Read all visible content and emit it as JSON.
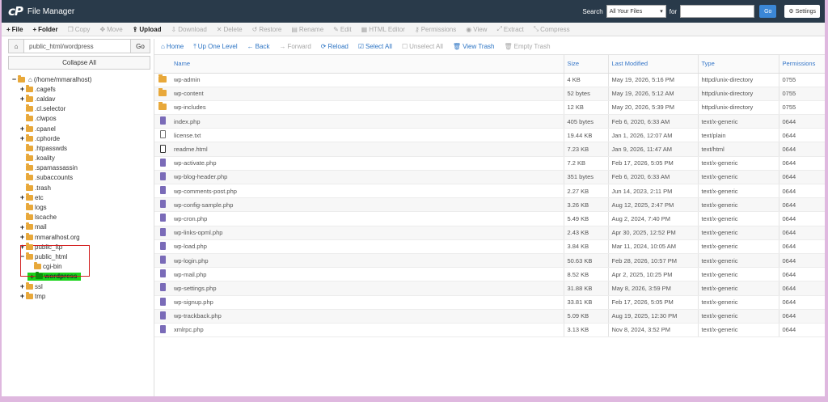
{
  "header": {
    "logo_text": "cP",
    "title": "File Manager",
    "search_label": "Search",
    "search_scope": "All Your Files",
    "for_label": "for",
    "search_value": "",
    "go_label": "Go",
    "settings_label": "Settings",
    "bg_color": "#293a4a",
    "accent_color": "#3b87d6"
  },
  "toolbar": {
    "items": [
      {
        "icon": "plus-icon",
        "label": "File",
        "state": "active"
      },
      {
        "icon": "plus-icon",
        "label": "Folder",
        "state": "active"
      },
      {
        "icon": "copy-icon",
        "label": "Copy",
        "state": "disabled"
      },
      {
        "icon": "move-icon",
        "label": "Move",
        "state": "disabled"
      },
      {
        "icon": "upload-icon",
        "label": "Upload",
        "state": "active"
      },
      {
        "icon": "download-icon",
        "label": "Download",
        "state": "disabled"
      },
      {
        "icon": "delete-icon",
        "label": "Delete",
        "state": "disabled"
      },
      {
        "icon": "restore-icon",
        "label": "Restore",
        "state": "disabled"
      },
      {
        "icon": "rename-icon",
        "label": "Rename",
        "state": "disabled"
      },
      {
        "icon": "edit-icon",
        "label": "Edit",
        "state": "disabled"
      },
      {
        "icon": "html-editor-icon",
        "label": "HTML Editor",
        "state": "disabled"
      },
      {
        "icon": "permissions-icon",
        "label": "Permissions",
        "state": "disabled"
      },
      {
        "icon": "view-icon",
        "label": "View",
        "state": "disabled"
      },
      {
        "icon": "extract-icon",
        "label": "Extract",
        "state": "disabled"
      },
      {
        "icon": "compress-icon",
        "label": "Compress",
        "state": "disabled"
      }
    ]
  },
  "sidebar": {
    "path_value": "public_html/wordpress",
    "go_label": "Go",
    "collapse_label": "Collapse All",
    "tree": [
      {
        "label": "(/home/mmaralhost)",
        "toggle": "−",
        "indent": 0,
        "home": true
      },
      {
        "label": ".cagefs",
        "toggle": "+",
        "indent": 1
      },
      {
        "label": ".caldav",
        "toggle": "+",
        "indent": 1
      },
      {
        "label": ".cl.selector",
        "toggle": "",
        "indent": 1
      },
      {
        "label": ".clwpos",
        "toggle": "",
        "indent": 1
      },
      {
        "label": ".cpanel",
        "toggle": "+",
        "indent": 1
      },
      {
        "label": ".cphorde",
        "toggle": "+",
        "indent": 1
      },
      {
        "label": ".htpasswds",
        "toggle": "",
        "indent": 1
      },
      {
        "label": ".koality",
        "toggle": "",
        "indent": 1
      },
      {
        "label": ".spamassassin",
        "toggle": "",
        "indent": 1
      },
      {
        "label": ".subaccounts",
        "toggle": "",
        "indent": 1
      },
      {
        "label": ".trash",
        "toggle": "",
        "indent": 1
      },
      {
        "label": "etc",
        "toggle": "+",
        "indent": 1
      },
      {
        "label": "logs",
        "toggle": "",
        "indent": 1
      },
      {
        "label": "lscache",
        "toggle": "",
        "indent": 1
      },
      {
        "label": "mail",
        "toggle": "+",
        "indent": 1
      },
      {
        "label": "mmaralhost.org",
        "toggle": "+",
        "indent": 1
      },
      {
        "label": "public_ftp",
        "toggle": "+",
        "indent": 1
      },
      {
        "label": "public_html",
        "toggle": "−",
        "indent": 1
      },
      {
        "label": "cgi-bin",
        "toggle": "",
        "indent": 2
      },
      {
        "label": "wordpress",
        "toggle": "+",
        "indent": 2,
        "selected": true
      },
      {
        "label": "ssl",
        "toggle": "+",
        "indent": 1
      },
      {
        "label": "tmp",
        "toggle": "+",
        "indent": 1
      }
    ]
  },
  "navbar": {
    "items": [
      {
        "icon": "home-icon",
        "label": "Home",
        "state": "active"
      },
      {
        "icon": "up-level-icon",
        "label": "Up One Level",
        "state": "active"
      },
      {
        "icon": "back-icon",
        "label": "Back",
        "state": "active"
      },
      {
        "icon": "forward-icon",
        "label": "Forward",
        "state": "disabled"
      },
      {
        "icon": "reload-icon",
        "label": "Reload",
        "state": "active"
      },
      {
        "icon": "select-all-icon",
        "label": "Select All",
        "state": "active"
      },
      {
        "icon": "unselect-all-icon",
        "label": "Unselect All",
        "state": "disabled"
      },
      {
        "icon": "trash-icon",
        "label": "View Trash",
        "state": "active"
      },
      {
        "icon": "empty-trash-icon",
        "label": "Empty Trash",
        "state": "disabled"
      }
    ]
  },
  "table": {
    "columns": [
      "Name",
      "Size",
      "Last Modified",
      "Type",
      "Permissions"
    ],
    "rows": [
      {
        "kind": "folder",
        "name": "wp-admin",
        "size": "4 KB",
        "modified": "May 19, 2026, 5:16 PM",
        "type": "httpd/unix-directory",
        "perms": "0755"
      },
      {
        "kind": "folder",
        "name": "wp-content",
        "size": "52 bytes",
        "modified": "May 19, 2026, 5:12 AM",
        "type": "httpd/unix-directory",
        "perms": "0755"
      },
      {
        "kind": "folder",
        "name": "wp-includes",
        "size": "12 KB",
        "modified": "May 20, 2026, 5:39 PM",
        "type": "httpd/unix-directory",
        "perms": "0755"
      },
      {
        "kind": "php",
        "name": "index.php",
        "size": "405 bytes",
        "modified": "Feb 6, 2020, 6:33 AM",
        "type": "text/x-generic",
        "perms": "0644"
      },
      {
        "kind": "text",
        "name": "license.txt",
        "size": "19.44 KB",
        "modified": "Jan 1, 2026, 12:07 AM",
        "type": "text/plain",
        "perms": "0644"
      },
      {
        "kind": "html",
        "name": "readme.html",
        "size": "7.23 KB",
        "modified": "Jan 9, 2026, 11:47 AM",
        "type": "text/html",
        "perms": "0644"
      },
      {
        "kind": "php",
        "name": "wp-activate.php",
        "size": "7.2 KB",
        "modified": "Feb 17, 2026, 5:05 PM",
        "type": "text/x-generic",
        "perms": "0644"
      },
      {
        "kind": "php",
        "name": "wp-blog-header.php",
        "size": "351 bytes",
        "modified": "Feb 6, 2020, 6:33 AM",
        "type": "text/x-generic",
        "perms": "0644"
      },
      {
        "kind": "php",
        "name": "wp-comments-post.php",
        "size": "2.27 KB",
        "modified": "Jun 14, 2023, 2:11 PM",
        "type": "text/x-generic",
        "perms": "0644"
      },
      {
        "kind": "php",
        "name": "wp-config-sample.php",
        "size": "3.26 KB",
        "modified": "Aug 12, 2025, 2:47 PM",
        "type": "text/x-generic",
        "perms": "0644"
      },
      {
        "kind": "php",
        "name": "wp-cron.php",
        "size": "5.49 KB",
        "modified": "Aug 2, 2024, 7:40 PM",
        "type": "text/x-generic",
        "perms": "0644"
      },
      {
        "kind": "php",
        "name": "wp-links-opml.php",
        "size": "2.43 KB",
        "modified": "Apr 30, 2025, 12:52 PM",
        "type": "text/x-generic",
        "perms": "0644"
      },
      {
        "kind": "php",
        "name": "wp-load.php",
        "size": "3.84 KB",
        "modified": "Mar 11, 2024, 10:05 AM",
        "type": "text/x-generic",
        "perms": "0644"
      },
      {
        "kind": "php",
        "name": "wp-login.php",
        "size": "50.63 KB",
        "modified": "Feb 28, 2026, 10:57 PM",
        "type": "text/x-generic",
        "perms": "0644"
      },
      {
        "kind": "php",
        "name": "wp-mail.php",
        "size": "8.52 KB",
        "modified": "Apr 2, 2025, 10:25 PM",
        "type": "text/x-generic",
        "perms": "0644"
      },
      {
        "kind": "php",
        "name": "wp-settings.php",
        "size": "31.88 KB",
        "modified": "May 8, 2026, 3:59 PM",
        "type": "text/x-generic",
        "perms": "0644"
      },
      {
        "kind": "php",
        "name": "wp-signup.php",
        "size": "33.81 KB",
        "modified": "Feb 17, 2026, 5:05 PM",
        "type": "text/x-generic",
        "perms": "0644"
      },
      {
        "kind": "php",
        "name": "wp-trackback.php",
        "size": "5.09 KB",
        "modified": "Aug 19, 2025, 12:30 PM",
        "type": "text/x-generic",
        "perms": "0644"
      },
      {
        "kind": "php",
        "name": "xmlrpc.php",
        "size": "3.13 KB",
        "modified": "Nov 8, 2024, 3:52 PM",
        "type": "text/x-generic",
        "perms": "0644"
      }
    ]
  }
}
